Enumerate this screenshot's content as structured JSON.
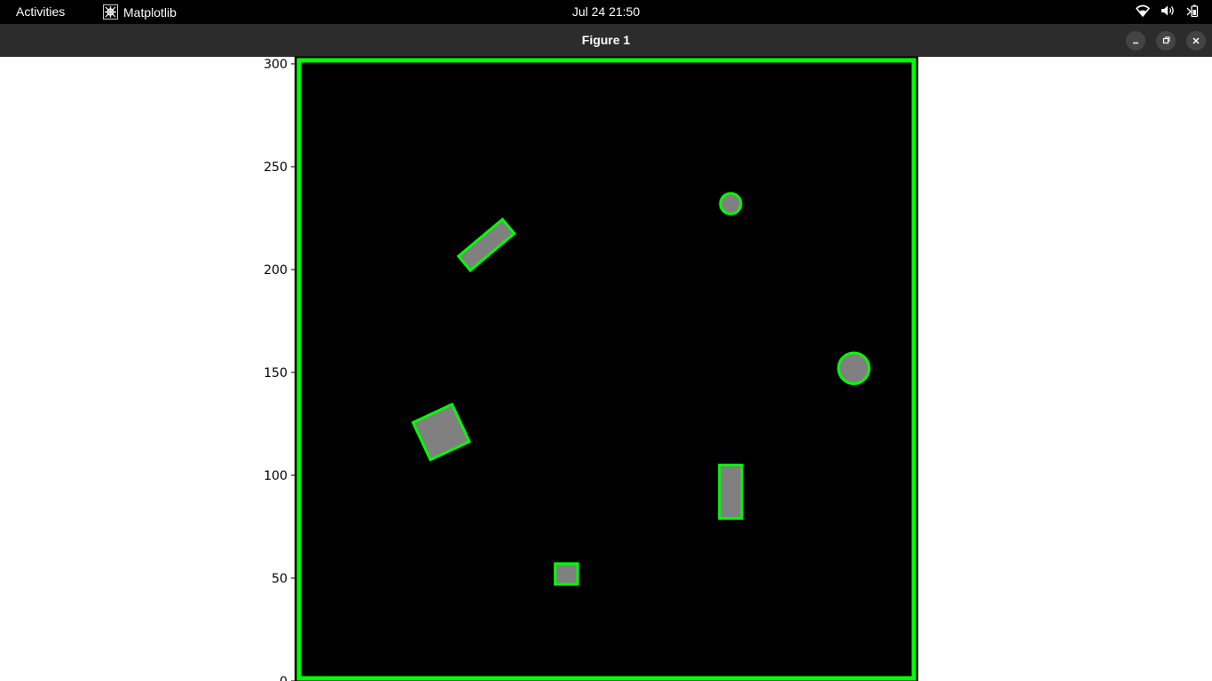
{
  "topbar": {
    "activities": "Activities",
    "app_name": "Matplotlib",
    "clock": "Jul 24  21:50",
    "icons": [
      "wifi-icon",
      "volume-icon",
      "battery-icon"
    ]
  },
  "window": {
    "title": "Figure 1",
    "buttons": [
      "minimize-icon",
      "maximize-icon",
      "close-icon"
    ]
  },
  "colors": {
    "background": "#000000",
    "occupied": "#808080",
    "border": "#00ff00",
    "topbar": "#000000",
    "titlebar": "#2c2c2c"
  },
  "chart_data": {
    "type": "image",
    "title": "",
    "xlabel": "",
    "ylabel": "",
    "ylim": [
      0,
      303
    ],
    "xlim": [
      0,
      303
    ],
    "y_ticks": [
      0,
      50,
      100,
      150,
      200,
      250,
      300
    ],
    "obstacles": [
      {
        "shape": "circle",
        "cx": 212,
        "cy": 232,
        "r": 5
      },
      {
        "shape": "circle",
        "cx": 272,
        "cy": 152,
        "r": 7.5
      },
      {
        "shape": "rotated-rect",
        "cx": 93,
        "cy": 212,
        "w": 28,
        "h": 9,
        "angle": -40
      },
      {
        "shape": "rotated-rect",
        "cx": 71,
        "cy": 121,
        "w": 21,
        "h": 20,
        "angle": -25
      },
      {
        "shape": "rect",
        "x0": 206.5,
        "y0": 79,
        "x1": 217.5,
        "y1": 105
      },
      {
        "shape": "rect",
        "x0": 126.5,
        "y0": 47,
        "x1": 137.5,
        "y1": 57
      }
    ]
  }
}
